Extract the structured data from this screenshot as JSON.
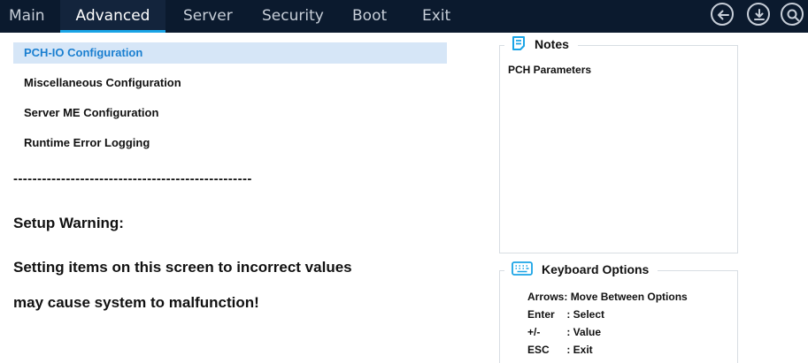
{
  "tabs": [
    {
      "label": "Main"
    },
    {
      "label": "Advanced"
    },
    {
      "label": "Server"
    },
    {
      "label": "Security"
    },
    {
      "label": "Boot"
    },
    {
      "label": "Exit"
    }
  ],
  "active_tab": "Advanced",
  "toolbar_icons": [
    "back-icon",
    "save-download-icon",
    "search-icon"
  ],
  "menu": [
    {
      "label": "PCH-IO Configuration",
      "selected": true
    },
    {
      "label": "Miscellaneous Configuration"
    },
    {
      "label": "Server ME Configuration"
    },
    {
      "label": "Runtime Error Logging"
    }
  ],
  "divider": "--------------------------------------------------",
  "warning": {
    "title": "Setup Warning:",
    "lines": [
      "Setting items on this screen to incorrect values",
      "may cause system to malfunction!"
    ]
  },
  "notes": {
    "title": "Notes",
    "text": "PCH Parameters"
  },
  "keyboard": {
    "title": "Keyboard Options",
    "rows": [
      {
        "key": "Arrows:",
        "desc": "Move Between Options"
      },
      {
        "key": "Enter",
        "desc": ": Select"
      },
      {
        "key": "+/-",
        "desc": ": Value"
      },
      {
        "key": "ESC",
        "desc": ": Exit"
      }
    ]
  },
  "colors": {
    "topbar": "#0b1a2e",
    "accent": "#1aa4e6",
    "selected_bg": "#d6e6f7",
    "selected_text": "#1a7fd0"
  }
}
